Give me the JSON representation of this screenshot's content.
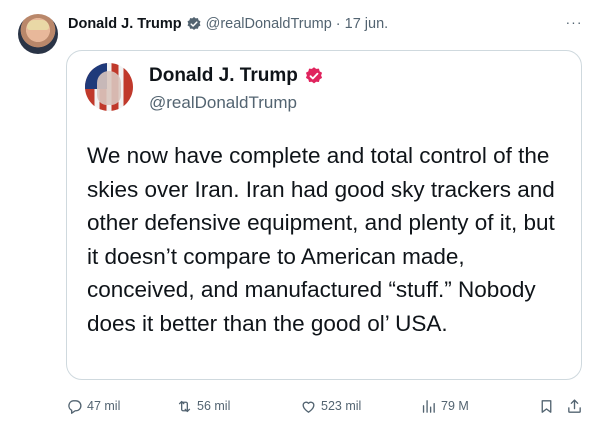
{
  "post": {
    "author_name": "Donald J. Trump",
    "handle": "@realDonaldTrump",
    "separator": "·",
    "date": "17 jun.",
    "more_label": "···"
  },
  "quoted": {
    "author_name": "Donald J. Trump",
    "handle": "@realDonaldTrump",
    "text": "We now have complete and total control of the skies over Iran. Iran had good sky trackers and other defensive equipment, and plenty of it, but it doesn’t compare to American made, conceived, and manufactured “stuff.” Nobody does it better than the good ol’ USA."
  },
  "actions": {
    "replies": "47 mil",
    "reposts": "56 mil",
    "likes": "523 mil",
    "views": "79 M"
  },
  "colors": {
    "badge_red": "#e0245e",
    "muted": "#536471",
    "border": "#cfd9de",
    "text": "#0f1419"
  },
  "icons": {
    "verified": "verified-badge-icon",
    "more": "more-dots-icon",
    "reply": "reply-icon",
    "repost": "repost-icon",
    "like": "heart-icon",
    "views": "views-chart-icon",
    "bookmark": "bookmark-icon",
    "share": "share-icon"
  }
}
